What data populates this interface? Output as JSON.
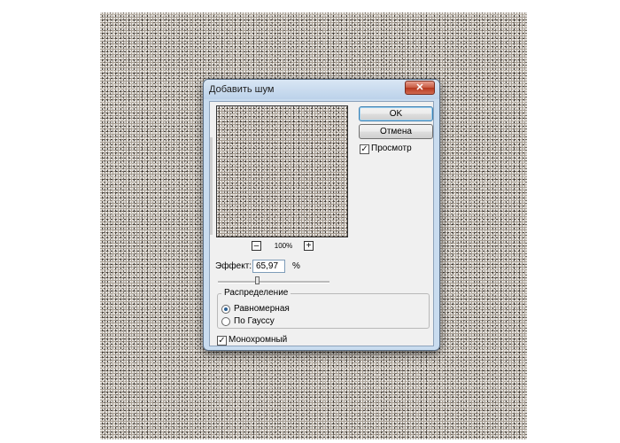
{
  "dialog": {
    "title": "Добавить шум",
    "close_symbol": "✕",
    "ok_label": "OK",
    "cancel_label": "Отмена",
    "preview_label": "Просмотр",
    "preview_checked": true,
    "zoom_level": "100%",
    "zoom_out_symbol": "–",
    "zoom_in_symbol": "+",
    "effect_label": "Эффект:",
    "effect_value": "65,97",
    "effect_unit": "%",
    "effect_slider_fraction": 0.35,
    "distribution_legend": "Распределение",
    "distribution_options": [
      "Равномерная",
      "По Гауссу"
    ],
    "distribution_selected": "Равномерная",
    "monochrome_label": "Монохромный",
    "monochrome_checked": true,
    "check_symbol": "✓"
  },
  "colors": {
    "noise_base": "#a89f94",
    "ok_focus": "#3c7fb1",
    "close_button": "#c75a41"
  }
}
